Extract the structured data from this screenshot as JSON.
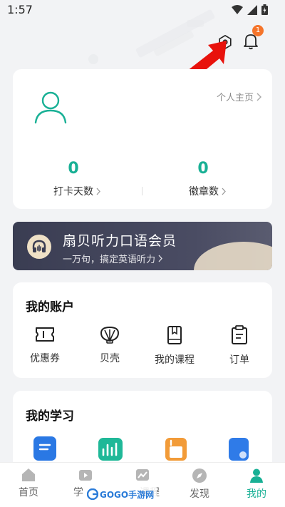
{
  "status_bar": {
    "time": "1:57"
  },
  "header": {
    "notification_count": "1"
  },
  "profile": {
    "homepage_link": "个人主页",
    "checkin_days_value": "0",
    "checkin_days_label": "打卡天数",
    "badges_value": "0",
    "badges_label": "徽章数"
  },
  "vip": {
    "title": "扇贝听力口语会员",
    "subtitle": "一万句，搞定英语听力"
  },
  "account": {
    "title": "我的账户",
    "items": [
      {
        "label": "优惠券",
        "icon": "ticket-icon"
      },
      {
        "label": "贝壳",
        "icon": "shell-icon"
      },
      {
        "label": "我的课程",
        "icon": "book-icon"
      },
      {
        "label": "订单",
        "icon": "clipboard-icon"
      }
    ]
  },
  "study": {
    "title": "我的学习"
  },
  "tabs": [
    {
      "label": "首页",
      "icon": "home-icon"
    },
    {
      "label": "学",
      "icon": "video-icon"
    },
    {
      "label": "课程",
      "icon": "chart-icon"
    },
    {
      "label": "发现",
      "icon": "compass-icon"
    },
    {
      "label": "我的",
      "icon": "person-icon"
    }
  ],
  "watermark": {
    "text": "GOGO手游网"
  },
  "colors": {
    "accent": "#18b095",
    "badge": "#f5742a",
    "vip_bg": "#3a3d52",
    "arrow": "#e8120c"
  }
}
